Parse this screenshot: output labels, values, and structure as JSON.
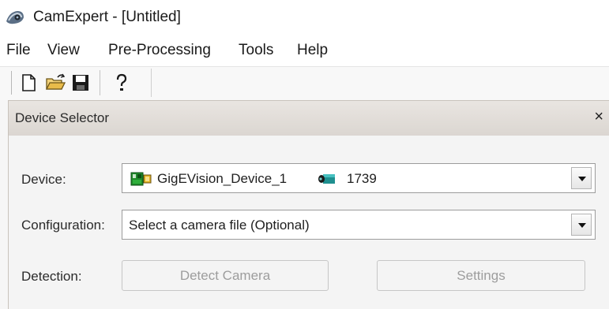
{
  "window": {
    "title": "CamExpert - [Untitled]"
  },
  "menu": {
    "items": [
      "File",
      "View",
      "Pre-Processing",
      "Tools",
      "Help"
    ]
  },
  "toolbar": {
    "icons": [
      "new-document-icon",
      "open-folder-icon",
      "save-disk-icon",
      "help-icon"
    ]
  },
  "panel": {
    "title": "Device Selector",
    "close_label": "×",
    "device_label": "Device:",
    "device_value": "GigEVision_Device_1",
    "device_serial": "1739",
    "configuration_label": "Configuration:",
    "configuration_value": "Select a camera file (Optional)",
    "detection_label": "Detection:",
    "detect_button": "Detect Camera",
    "settings_button": "Settings"
  }
}
